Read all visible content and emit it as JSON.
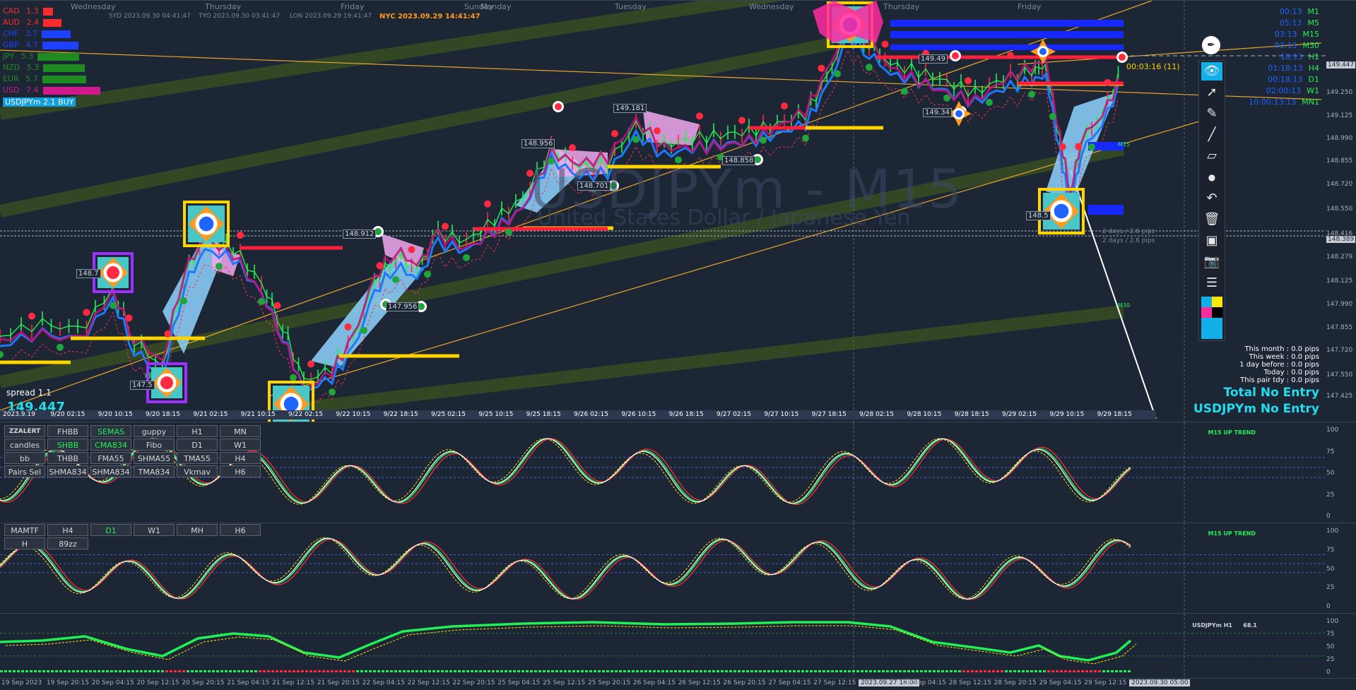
{
  "chart": {
    "symbol_timeframe": "USDJPYm - M15",
    "description": "United States Dollar / Japanese Yen",
    "nyc_time": "NYC 2023.09.29 14:41:47",
    "syd_time": "SYD 2023.09.30 04:41:47",
    "tyo_time": "TYO 2023.09.30 03:41:47",
    "lon_time": "LON 2023.09.29 19:41:47",
    "weekdays_top": [
      "Wednesday",
      "Thursday",
      "Friday",
      "Sunday",
      "Monday",
      "Tuesday",
      "Wednesday",
      "Thursday",
      "Friday"
    ],
    "countdown": "00:03:16 (11)",
    "spread_label": "spread 1.1",
    "bid_price": "149.447",
    "signal_badge": "USDJPYm 2.1 BUY",
    "price_tags": [
      "149.181",
      "148.956",
      "148.701",
      "148.858",
      "147.956",
      "148.912",
      "147.5",
      "148.7",
      "148.5",
      "149.49",
      "149.34"
    ],
    "rr_text_1": "2 days / 2.6 pips",
    "rr_text_2": "2 days / 2.6 pips",
    "panel_tags": [
      "M15",
      "M30"
    ]
  },
  "currency_strength": [
    {
      "code": "CAD",
      "value": "1.3",
      "color": "#ff2a2a"
    },
    {
      "code": "AUD",
      "value": "2.4",
      "color": "#ff2a2a"
    },
    {
      "code": "CHF",
      "value": "3.7",
      "color": "#1e40ff"
    },
    {
      "code": "GBP",
      "value": "4.7",
      "color": "#1e40ff"
    },
    {
      "code": "JPY",
      "value": "5.3",
      "color": "#1f8a1f"
    },
    {
      "code": "NZD",
      "value": "5.3",
      "color": "#1f8a1f"
    },
    {
      "code": "EUR",
      "value": "5.7",
      "color": "#1f8a1f"
    },
    {
      "code": "USD",
      "value": "7.4",
      "color": "#d0198c"
    }
  ],
  "timeframes": [
    {
      "time": "00:13",
      "name": "M1"
    },
    {
      "time": "05:13",
      "name": "M5"
    },
    {
      "time": "03:13",
      "name": "M15"
    },
    {
      "time": "03:13",
      "name": "M30"
    },
    {
      "time": "18:13",
      "name": "H1"
    },
    {
      "time": "01:18:13",
      "name": "H4"
    },
    {
      "time": "00:18:13",
      "name": "D1"
    },
    {
      "time": "02:00:13",
      "name": "W1"
    },
    {
      "time": "10:00:13:13",
      "name": "MN1"
    }
  ],
  "pips": {
    "this_month": "This month : 0.0 pips",
    "this_week": "This week : 0.0 pips",
    "day_before": "1 day before : 0.0 pips",
    "today": "Today : 0.0 pips",
    "this_pair": "This pair tdy : 0.0 pips"
  },
  "no_entry": {
    "total": "Total No Entry",
    "pair": "USDJPYm No Entry"
  },
  "buttons_panel1": [
    [
      "ZZALERT",
      "FHBB",
      "SEMAS",
      "guppy",
      "H1",
      "MN"
    ],
    [
      "candles",
      "SHBB",
      "CMA834",
      "Fibo",
      "D1",
      "W1"
    ],
    [
      "bb",
      "THBB",
      "FMA55",
      "SHMA55",
      "TMA55",
      "H4"
    ],
    [
      "Pairs Sel",
      "SHMA834",
      "SHMA834",
      "TMA834",
      "Vkmav",
      "H6"
    ]
  ],
  "buttons_panel2": [
    [
      "MAMTF",
      "H4",
      "D1",
      "W1",
      "MH",
      "H6"
    ],
    [
      "H",
      "89zz"
    ]
  ],
  "indicator_titles": {
    "ind1": "M15 UP TREND",
    "ind2": "M15 UP TREND",
    "ind3": "USDJPYm H1",
    "ind3_value": "68.1"
  },
  "yaxis_main": [
    "149.447",
    "149.250",
    "149.125",
    "148.990",
    "148.855",
    "148.720",
    "148.550",
    "148.416",
    "148.389",
    "148.279",
    "148.125",
    "147.990",
    "147.855",
    "147.720",
    "147.550",
    "147.425"
  ],
  "yaxis_ind": [
    "100",
    "75",
    "50",
    "25",
    "0"
  ],
  "dates_main": [
    "2023.9.19",
    "9/20 02:15",
    "9/20 10:15",
    "9/20 18:15",
    "9/21 02:15",
    "9/21 10:15",
    "9/22 02:15",
    "9/22 10:15",
    "9/22 18:15",
    "9/25 02:15",
    "9/25 10:15",
    "9/25 18:15",
    "9/26 02:15",
    "9/26 10:15",
    "9/26 18:15",
    "9/27 02:15",
    "9/27 10:15",
    "9/27 18:15",
    "9/28 02:15",
    "9/28 10:15",
    "9/28 18:15",
    "9/29 02:15",
    "9/29 10:15",
    "9/29 18:15"
  ],
  "dates_bottom": [
    "19 Sep 2023",
    "19 Sep 20:15",
    "20 Sep 04:15",
    "20 Sep 12:15",
    "20 Sep 20:15",
    "21 Sep 04:15",
    "21 Sep 12:15",
    "21 Sep 20:15",
    "22 Sep 04:15",
    "22 Sep 12:15",
    "22 Sep 20:15",
    "25 Sep 04:15",
    "25 Sep 12:15",
    "25 Sep 20:15",
    "26 Sep 04:15",
    "26 Sep 12:15",
    "26 Sep 20:15",
    "27 Sep 04:15",
    "27 Sep 12:15",
    "2023.09.27 18:00",
    "28 Sep 04:15",
    "28 Sep 12:15",
    "28 Sep 20:15",
    "29 Sep 04:15",
    "29 Sep 12:15",
    "2023.09.30 05:00"
  ],
  "colors": {
    "background": "#1d2635",
    "bull": "#22ee55",
    "bear": "#ff2a40",
    "ma_blue": "#1e78ff",
    "ma_magenta": "#c0107a",
    "fill_blue": "#8fd4ff",
    "fill_pink": "#f2a9ef",
    "yellow_level": "#ffd400",
    "red_level": "#ff1e3c",
    "channel": "#3b5320",
    "trendline": "#e7a72a"
  }
}
